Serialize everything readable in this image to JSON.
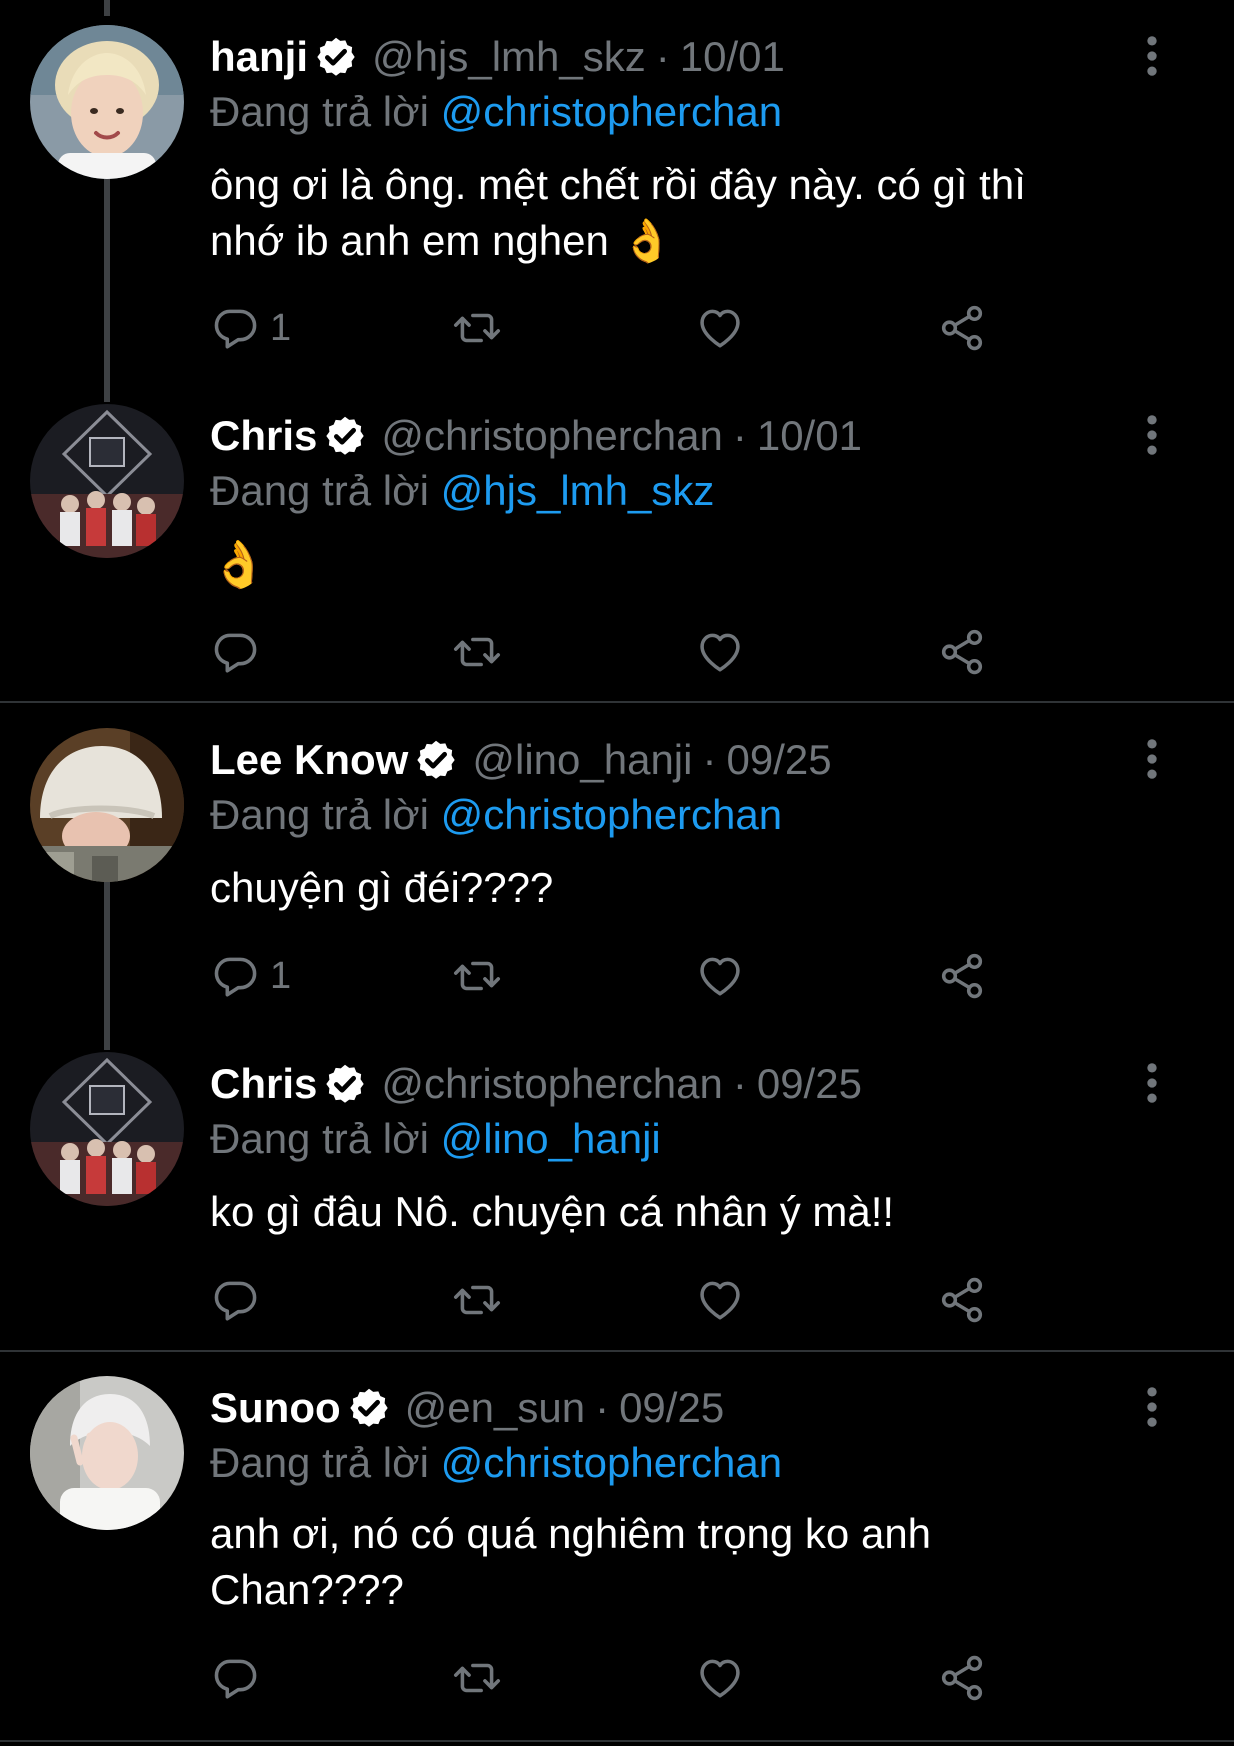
{
  "colors": {
    "background": "#000000",
    "text": "#ffffff",
    "muted": "#71767b",
    "link": "#1d9bf0",
    "divider": "#2f3336",
    "thread_line": "#3e4144"
  },
  "icons": {
    "verified": "verified-badge-icon",
    "more": "more-vertical-icon",
    "reply": "reply-bubble-icon",
    "retweet": "retweet-icon",
    "like": "heart-icon",
    "share": "share-icon"
  },
  "tweets": [
    {
      "name": "hanji",
      "handle": "@hjs_lmh_skz",
      "separator": "·",
      "date": "10/01",
      "reply_prefix": "Đang trả lời",
      "reply_to": "@christopherchan",
      "text": "ông ơi là ông. mệt chết rồi đây này. có gì thì\nnhớ ib anh em nghen 👌",
      "reply_count": "1"
    },
    {
      "name": "Chris",
      "handle": "@christopherchan",
      "separator": "·",
      "date": "10/01",
      "reply_prefix": "Đang trả lời",
      "reply_to": "@hjs_lmh_skz",
      "text": "👌",
      "reply_count": ""
    },
    {
      "name": "Lee Know",
      "handle": "@lino_hanji",
      "separator": "·",
      "date": "09/25",
      "reply_prefix": "Đang trả lời",
      "reply_to": "@christopherchan",
      "text": "chuyện gì đéi????",
      "reply_count": "1"
    },
    {
      "name": "Chris",
      "handle": "@christopherchan",
      "separator": "·",
      "date": "09/25",
      "reply_prefix": "Đang trả lời",
      "reply_to": "@lino_hanji",
      "text": "ko gì đâu Nô. chuyện cá nhân ý mà!!",
      "reply_count": ""
    },
    {
      "name": "Sunoo",
      "handle": "@en_sun",
      "separator": "·",
      "date": "09/25",
      "reply_prefix": "Đang trả lời",
      "reply_to": "@christopherchan",
      "text": "anh ơi, nó có quá nghiêm trọng ko anh\nChan????",
      "reply_count": ""
    }
  ]
}
